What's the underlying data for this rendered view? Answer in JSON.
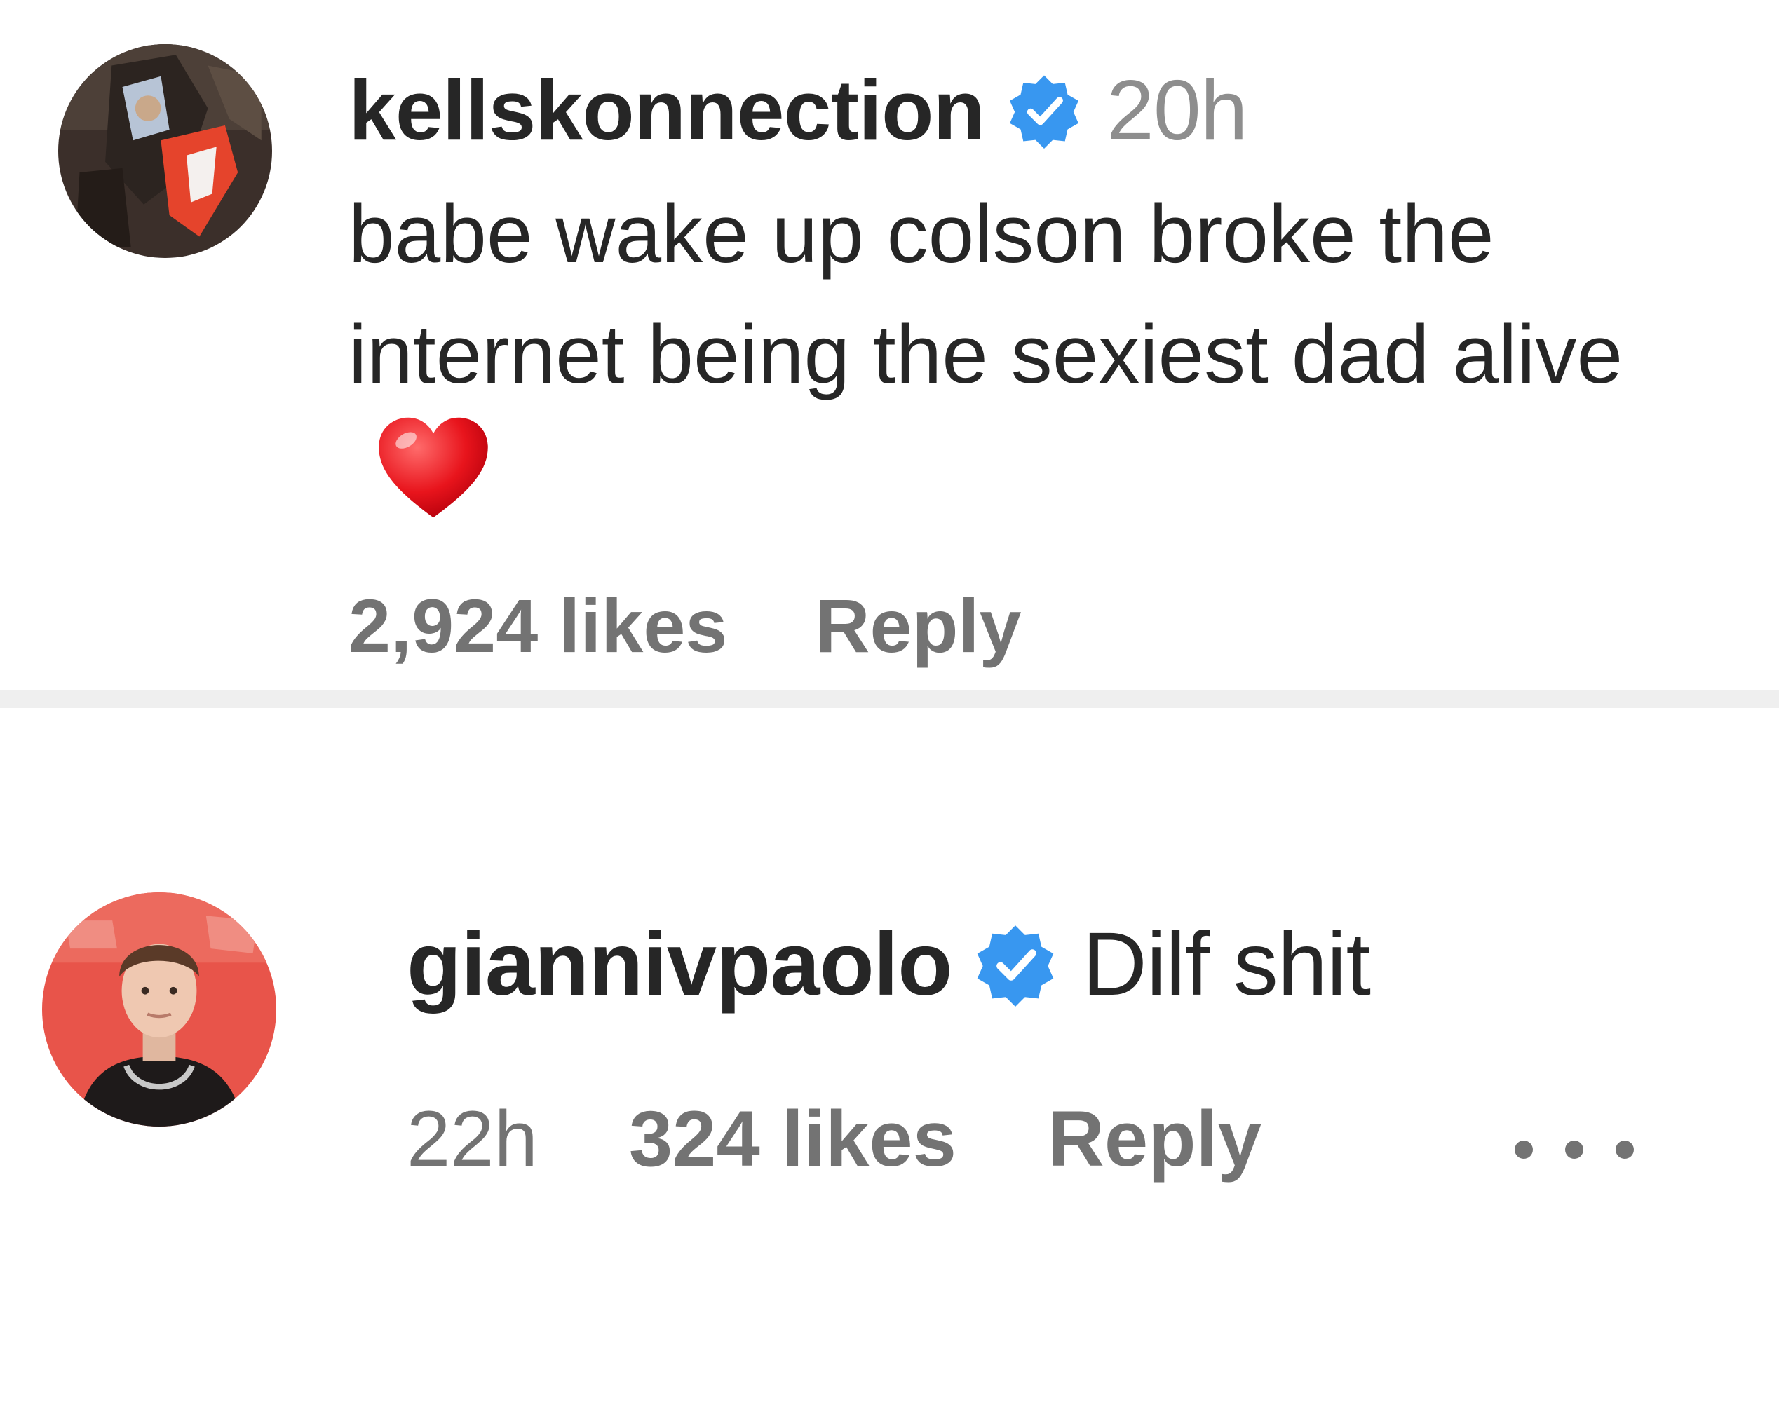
{
  "comments": [
    {
      "username": "kellskonnection",
      "verified": true,
      "time": "20h",
      "text": "babe wake up colson broke the internet being the sexiest dad alive",
      "emoji": "red-heart",
      "likes": "2,924 likes",
      "reply_label": "Reply"
    },
    {
      "username": "giannivpaolo",
      "verified": true,
      "text": "Dilf shit",
      "time": "22h",
      "likes": "324 likes",
      "reply_label": "Reply",
      "more_icon": "more-options-icon"
    }
  ],
  "colors": {
    "verified_blue": "#3897f0",
    "meta_gray": "#737373",
    "divider": "#efefef",
    "text": "#262626"
  }
}
